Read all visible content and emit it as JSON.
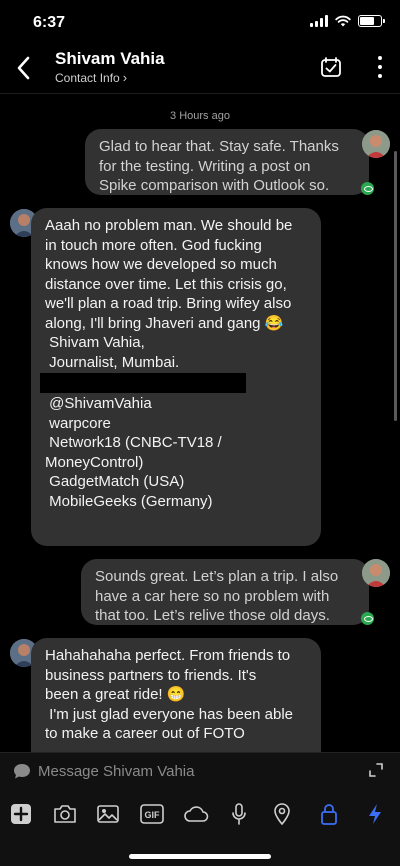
{
  "status": {
    "time": "6:37"
  },
  "header": {
    "title": "Shivam Vahia",
    "subtitle": "Contact Info",
    "subtitle_chevron": "›"
  },
  "conversation": {
    "timestamp": "3 Hours ago",
    "messages": [
      {
        "direction": "outgoing",
        "text": "Glad to hear that. Stay safe. Thanks for the testing. Writing a post on Spike comparison with Outlook so.",
        "lines": [
          "Glad to hear that. Stay safe. Thanks",
          "for the testing. Writing a post on",
          "Spike comparison with Outlook so."
        ]
      },
      {
        "direction": "incoming",
        "lines": [
          "Aaah no problem man. We should be",
          "in touch more often. God fucking",
          "knows how we developed so much",
          "distance over time. Let this crisis go,",
          "we'll plan a road trip. Bring wifey also",
          "along, I'll bring Jhaveri and gang 😂",
          "",
          " Shivam Vahia,",
          " Journalist, Mumbai.",
          "",
          " @ShivamVahia",
          "",
          " warpcore",
          " Network18 (CNBC-TV18 /",
          "MoneyControl)",
          " GadgetMatch (USA)",
          " MobileGeeks (Germany)"
        ]
      },
      {
        "direction": "outgoing",
        "lines": [
          "Sounds great. Let’s plan a trip. I also",
          "have a car here so no problem with",
          "that too. Let’s relive those old days."
        ]
      },
      {
        "direction": "incoming",
        "lines": [
          "Hahahahaha perfect. From friends to",
          "business partners to friends. It's",
          "been a great ride! 😁",
          "",
          " I'm just glad everyone has been able",
          "to make a career out of FOTO"
        ]
      }
    ]
  },
  "composer": {
    "placeholder": "Message Shivam Vahia",
    "tools": [
      "add-icon",
      "camera-icon",
      "gallery-icon",
      "gif-icon",
      "cloud-icon",
      "microphone-icon",
      "location-icon",
      "lock-icon",
      "lightning-icon"
    ],
    "gif_label": "GIF"
  },
  "colors": {
    "accent": "#3b6ff5",
    "bubble": "#323232",
    "seen": "#2aa84f",
    "background": "#000000"
  }
}
